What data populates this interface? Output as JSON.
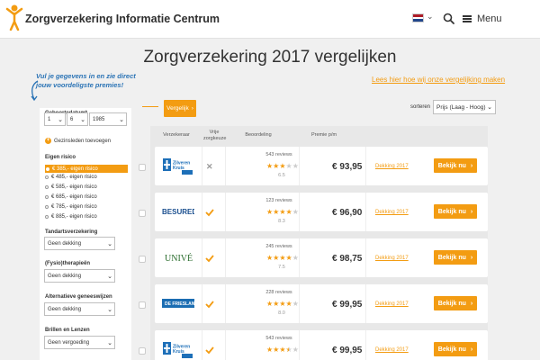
{
  "header": {
    "brand": "Zorgverzekering Informatie Centrum",
    "menu_label": "Menu"
  },
  "page": {
    "title": "Zorgverzekering 2017 vergelijken",
    "compare_link": "Lees hier hoe wij onze vergelijking maken",
    "promo": "Vul je gegevens in en zie direct jouw voordeligste premies!"
  },
  "filters": {
    "dob_label": "Geboortedatum*",
    "dob_day": "1",
    "dob_month": "6",
    "dob_year": "1985",
    "partner_link": "Gezinsleden toevoegen",
    "risk_label": "Eigen risico",
    "risk_options": [
      "€ 385,- eigen risico",
      "€ 485,- eigen risico",
      "€ 585,- eigen risico",
      "€ 685,- eigen risico",
      "€ 785,- eigen risico",
      "€ 885,- eigen risico"
    ],
    "tand_label": "Tandartsverzekering",
    "tand_value": "Geen dekking",
    "fysio_label": "(Fysio)therapieën",
    "fysio_value": "Geen dekking",
    "alt_label": "Alternatieve geneeswijzen",
    "alt_value": "Geen dekking",
    "bril_label": "Brillen en Lenzen",
    "bril_value": "Geen vergoeding"
  },
  "toolbar": {
    "compare_label": "Vergelijk",
    "sort_label": "sorteren",
    "sort_value": "Prijs (Laag - Hoog)"
  },
  "columns": {
    "insurer": "Verzekeraar",
    "choice": "Vrije zorgkeuze",
    "rating": "Beoordeling",
    "premium": "Premie p/m"
  },
  "rows": [
    {
      "logo": "Zilveren Kruis",
      "choice": "no",
      "reviews": "543 reviews",
      "stars": 3,
      "score": "6.5",
      "price": "€ 93,95",
      "dekking": "Dekking 2017",
      "button": "Bekijk nu"
    },
    {
      "logo": "BESURED",
      "choice": "yes",
      "reviews": "123 reviews",
      "stars": 4,
      "score": "8.3",
      "price": "€ 96,90",
      "dekking": "Dekking 2017",
      "button": "Bekijk nu"
    },
    {
      "logo": "UNIVÉ",
      "choice": "yes",
      "reviews": "245 reviews",
      "stars": 4,
      "score": "7.5",
      "price": "€ 98,75",
      "dekking": "Dekking 2017",
      "button": "Bekijk nu"
    },
    {
      "logo": "DE FRIESLAND",
      "choice": "yes",
      "reviews": "228 reviews",
      "stars": 4,
      "score": "8.0",
      "price": "€ 99,95",
      "dekking": "Dekking 2017",
      "button": "Bekijk nu"
    },
    {
      "logo": "Zilveren Kruis",
      "choice": "yes",
      "reviews": "543 reviews",
      "stars": 3.5,
      "score": "",
      "price": "€ 99,95",
      "dekking": "Dekking 2017",
      "button": "Bekijk nu"
    }
  ],
  "colors": {
    "accent": "#f39c12",
    "brand_blue": "#2a73b5"
  }
}
